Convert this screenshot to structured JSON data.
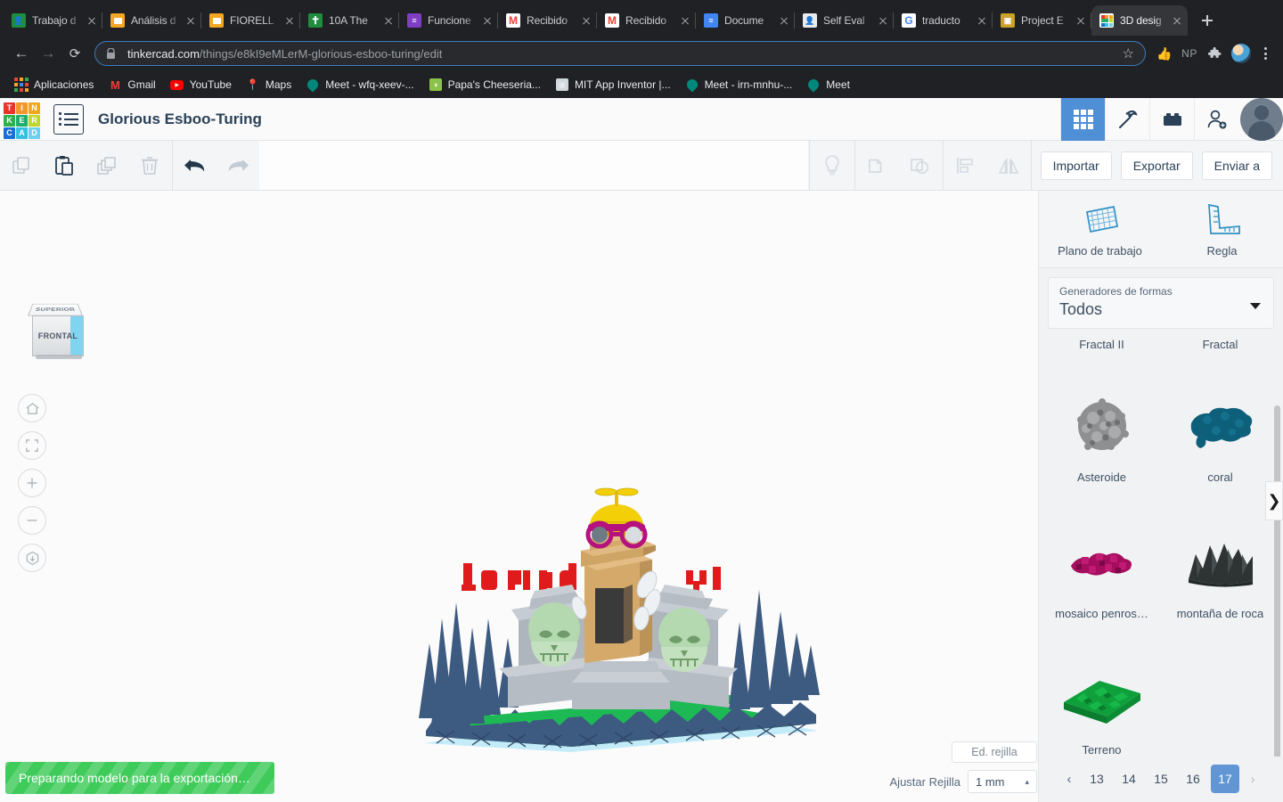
{
  "browser": {
    "tabs": [
      {
        "title": "Trabajo d",
        "favicon": "contacts-icon",
        "color": "#1e8e3e",
        "glyph": "■",
        "active": false
      },
      {
        "title": "Análisis d",
        "favicon": "slides-icon",
        "color": "#f5a623",
        "glyph": "",
        "active": false
      },
      {
        "title": "FIORELL",
        "favicon": "slides-icon",
        "color": "#f5a623",
        "glyph": "",
        "active": false
      },
      {
        "title": "10A The",
        "favicon": "classroom-icon",
        "color": "#1e8e3e",
        "glyph": "†",
        "active": false
      },
      {
        "title": "Funcione",
        "favicon": "forms-icon",
        "color": "#7e3fc4",
        "glyph": "≡",
        "active": false
      },
      {
        "title": "Recibido",
        "favicon": "gmail-icon",
        "color": "#ea4335",
        "glyph": "M",
        "active": false
      },
      {
        "title": "Recibido",
        "favicon": "gmail-icon",
        "color": "#ea4335",
        "glyph": "M",
        "active": false
      },
      {
        "title": "Docume",
        "favicon": "docs-icon",
        "color": "#4285f4",
        "glyph": "≡",
        "active": false
      },
      {
        "title": "Self Eval",
        "favicon": "contacts-icon",
        "color": "#5f6368",
        "glyph": "■",
        "active": false
      },
      {
        "title": "traducto",
        "favicon": "google-icon",
        "color": "#ffffff",
        "glyph": "G",
        "active": false
      },
      {
        "title": "Project E",
        "favicon": "photo-icon",
        "color": "#c9a227",
        "glyph": "▣",
        "active": false
      },
      {
        "title": "3D desig",
        "favicon": "tinkercad-icon",
        "color": "#ffffff",
        "glyph": "",
        "active": true
      }
    ],
    "new_tab_label": "+",
    "nav": {
      "back": "←",
      "forward": "→",
      "reload": "⟳"
    },
    "url_domain": "tinkercad.com",
    "url_path": "/things/e8kI9eMLerM-glorious-esboo-turing/edit",
    "lock_icon": "lock-icon",
    "star_icon": "star-icon",
    "extensions": [
      {
        "name": "thumbs-up-extension-icon",
        "glyph": "👍"
      },
      {
        "name": "np-extension-icon",
        "glyph": "NP"
      },
      {
        "name": "puzzle-extension-icon",
        "glyph": "🧩"
      }
    ],
    "bookmarks": [
      {
        "label": "Aplicaciones",
        "icon": "apps-grid-icon",
        "color": "#f5a623"
      },
      {
        "label": "Gmail",
        "icon": "gmail-icon",
        "color": "#ea4335",
        "glyph": "M"
      },
      {
        "label": "YouTube",
        "icon": "youtube-icon",
        "color": "#ff0000",
        "glyph": "▶"
      },
      {
        "label": "Maps",
        "icon": "maps-icon",
        "color": "#34a853",
        "glyph": "📍"
      },
      {
        "label": "Meet - wfq-xeev-...",
        "icon": "meet-icon",
        "color": "#00897b",
        "glyph": "📹"
      },
      {
        "label": "Papa's Cheeseria...",
        "icon": "papas-icon",
        "color": "#8bc34a",
        "glyph": "●"
      },
      {
        "label": "MIT App Inventor |...",
        "icon": "appinventor-icon",
        "color": "#a1887f",
        "glyph": "▣"
      },
      {
        "label": "Meet - irn-mnhu-...",
        "icon": "meet-icon",
        "color": "#00897b",
        "glyph": "📹"
      },
      {
        "label": "Meet",
        "icon": "meet-icon",
        "color": "#00897b",
        "glyph": "📹"
      }
    ]
  },
  "tinkercad": {
    "logo": {
      "tiles": [
        {
          "letter": "T",
          "color": "#e8342a"
        },
        {
          "letter": "I",
          "color": "#f5962b"
        },
        {
          "letter": "N",
          "color": "#f2a71b"
        },
        {
          "letter": "K",
          "color": "#2bb24a"
        },
        {
          "letter": "E",
          "color": "#1fae6a"
        },
        {
          "letter": "R",
          "color": "#bfd62e"
        },
        {
          "letter": "C",
          "color": "#1a6fd4"
        },
        {
          "letter": "A",
          "color": "#36bfe0"
        },
        {
          "letter": "D",
          "color": "#6ed0ef"
        }
      ]
    },
    "menu_icon": "list-menu-icon",
    "doc_title": "Glorious Esboo-Turing",
    "header_icons": [
      {
        "name": "blocks-grid-icon",
        "active": true
      },
      {
        "name": "minecraft-pickaxe-icon",
        "active": false
      },
      {
        "name": "lego-brick-icon",
        "active": false
      },
      {
        "name": "add-person-icon",
        "active": false
      }
    ],
    "avatar": "user-avatar",
    "toolbar": {
      "copy_label": "copy-icon",
      "paste_label": "paste-icon",
      "duplicate_label": "duplicate-icon",
      "delete_label": "delete-icon",
      "undo_label": "undo-icon",
      "redo_label": "redo-icon",
      "hint_label": "lightbulb-icon",
      "group_label": "group-icon",
      "ungroup_label": "ungroup-icon",
      "align_label": "align-icon",
      "mirror_label": "mirror-icon",
      "import_btn": "Importar",
      "export_btn": "Exportar",
      "sendto_btn": "Enviar a"
    },
    "viewcube": {
      "top_face": "SUPERIOR",
      "front_face": "FRONTAL"
    },
    "view_controls": [
      {
        "name": "home-view-button",
        "glyph": "⌂"
      },
      {
        "name": "fit-to-view-button",
        "glyph": "⛶"
      },
      {
        "name": "zoom-in-button",
        "glyph": "+"
      },
      {
        "name": "zoom-out-button",
        "glyph": "−"
      },
      {
        "name": "perspective-toggle-button",
        "glyph": "⬡"
      }
    ],
    "panel": {
      "collapse_glyph": "❯",
      "tools": [
        {
          "label": "Plano de trabajo",
          "icon": "workplane-icon"
        },
        {
          "label": "Regla",
          "icon": "ruler-icon"
        }
      ],
      "dropdown": {
        "label": "Generadores de formas",
        "value": "Todos",
        "caret": "chevron-down-icon"
      },
      "top_row_labels": [
        "Fractal II",
        "Fractal"
      ],
      "shapes": [
        {
          "label": "Asteroide",
          "color": "#8d8f91",
          "shape": "asteroid"
        },
        {
          "label": "coral",
          "color": "#0d5f7a",
          "shape": "coral"
        },
        {
          "label": "mosaico penros…",
          "color": "#a50d5e",
          "shape": "penrose"
        },
        {
          "label": "montaña de roca",
          "color": "#2e3334",
          "shape": "rockmountain"
        },
        {
          "label": "Terreno",
          "color": "#0fa03c",
          "shape": "terrain"
        }
      ],
      "pagination": {
        "prev": "‹",
        "next": "›",
        "pages": [
          "13",
          "14",
          "15",
          "16",
          "17"
        ],
        "current": "17"
      }
    },
    "status": {
      "progress_text": "Preparando modelo para la exportación…",
      "progress_color": "#3ecb5a"
    },
    "grid_controls": {
      "edit_grid_btn": "Ed. rejilla",
      "snap_label": "Ajustar Rejilla",
      "snap_value": "1 mm",
      "snap_caret": "▴"
    }
  },
  "model": {
    "name": "graveyard-temple-3d-model",
    "description": "Green terrain base with dark blue-grey spiky bushes, grey stone tombs and steps, tan central monument with dark doorway, two pale green skulls, yellow propeller-beanie with magenta goggles on top, white feather shapes, red 3D text behind",
    "colors": {
      "terrain_green": "#1db954",
      "bush_blue": "#3d5a80",
      "stone_grey": "#b6bcc4",
      "monument_tan": "#d4a96a",
      "skull_green": "#b4d8b0",
      "helmet_yellow": "#f2cf07",
      "goggle_magenta": "#b5127e",
      "text_red": "#e01b1b",
      "base_cyan": "#b9e9f7",
      "doorway_dark": "#3a3a3a"
    }
  }
}
